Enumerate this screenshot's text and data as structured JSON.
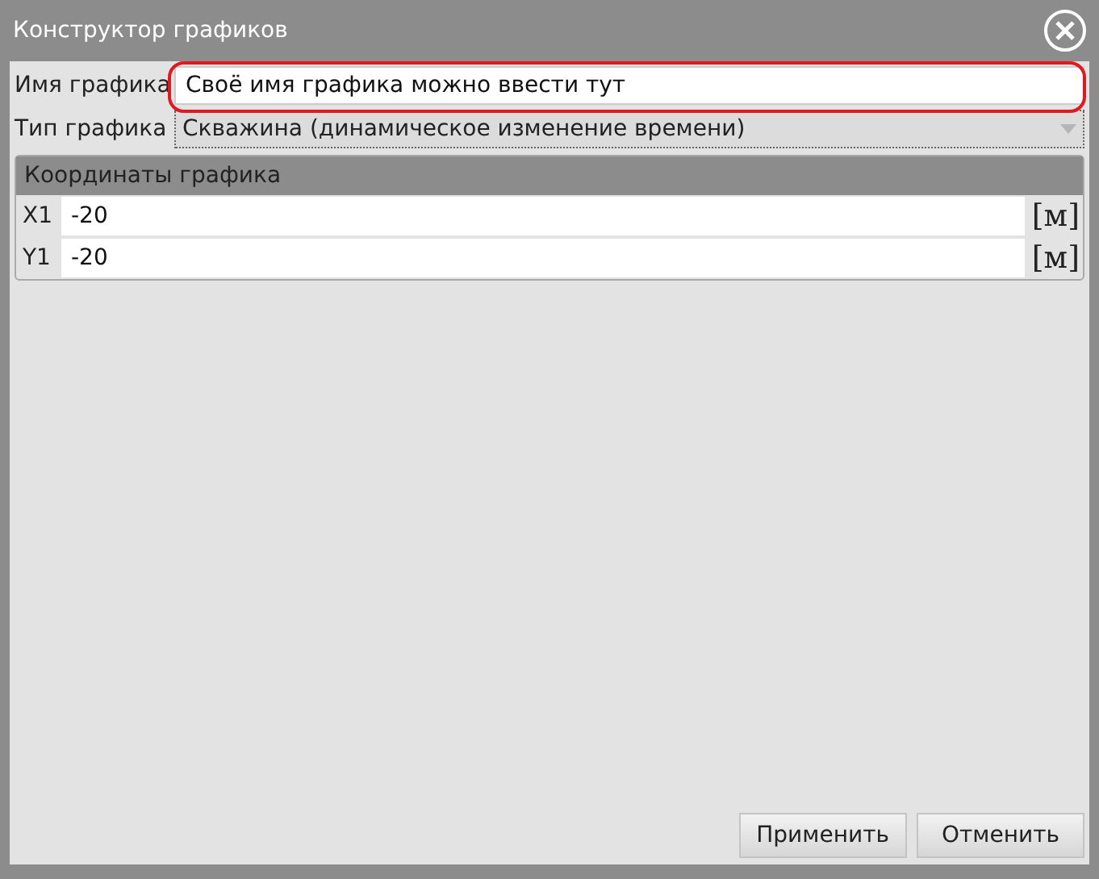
{
  "window": {
    "title": "Конструктор графиков"
  },
  "name_field": {
    "label": "Имя графика",
    "value": "Своё имя графика можно ввести тут",
    "highlighted": true
  },
  "type_field": {
    "label": "Тип графика",
    "value": "Скважина (динамическое изменение времени)"
  },
  "coordinates": {
    "title": "Координаты графика",
    "rows": [
      {
        "label": "X1",
        "value": "-20",
        "unit": "[м]"
      },
      {
        "label": "Y1",
        "value": "-20",
        "unit": "[м]"
      }
    ]
  },
  "buttons": [
    "Применить",
    "Отменить"
  ]
}
